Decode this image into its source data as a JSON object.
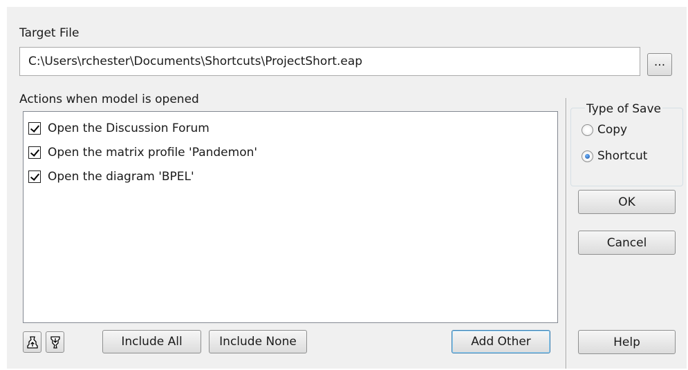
{
  "target_file": {
    "label": "Target File",
    "path": "C:\\Users\\rchester\\Documents\\Shortcuts\\ProjectShort.eap",
    "browse_label": "..."
  },
  "actions": {
    "label": "Actions when model is opened",
    "items": [
      {
        "label": "Open the Discussion Forum",
        "checked": true
      },
      {
        "label": "Open the matrix profile 'Pandemon'",
        "checked": true
      },
      {
        "label": "Open the diagram 'BPEL'",
        "checked": true
      }
    ]
  },
  "type_of_save": {
    "label": "Type of Save",
    "options": [
      {
        "label": "Copy",
        "selected": false
      },
      {
        "label": "Shortcut",
        "selected": true
      }
    ]
  },
  "buttons": {
    "ok": "OK",
    "cancel": "Cancel",
    "include_all": "Include All",
    "include_none": "Include None",
    "add_other": "Add Other",
    "help": "Help"
  },
  "toolbar_icons": [
    "move-up-icon",
    "move-down-icon"
  ]
}
